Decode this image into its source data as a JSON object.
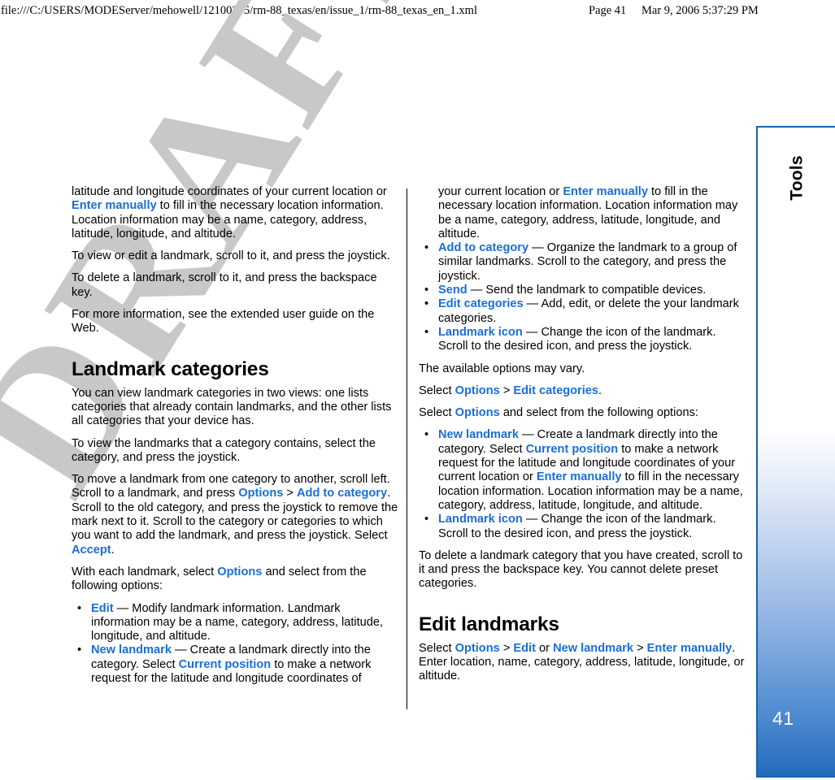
{
  "print_header": {
    "file_path": "file:///C:/USERS/MODEServer/mehowell/12100235/rm-88_texas/en/issue_1/rm-88_texas_en_1.xml",
    "page_label": "Page 41",
    "timestamp": "Mar 9, 2006 5:37:29 PM"
  },
  "watermark": {
    "text": "DRAFT",
    "color": "#c8c8c8"
  },
  "colors": {
    "link": "#1b6ed6",
    "tab_border": "#1663ad",
    "tab_gradient_end": "#2269bd",
    "text": "#000000"
  },
  "side_tab": {
    "label": "Tools",
    "page_number": "41"
  },
  "left_column": {
    "blocks": [
      {
        "type": "paragraph",
        "runs": [
          {
            "text": "latitude and longitude coordinates of your current location or ",
            "style": "normal"
          },
          {
            "text": "Enter manually",
            "style": "link"
          },
          {
            "text": " to fill in the necessary location information. Location information may be a name, category, address, latitude, longitude, and altitude.",
            "style": "normal"
          }
        ]
      },
      {
        "type": "paragraph",
        "runs": [
          {
            "text": "To view or edit a landmark, scroll to it, and press the joystick.",
            "style": "normal"
          }
        ]
      },
      {
        "type": "paragraph",
        "runs": [
          {
            "text": "To delete a landmark, scroll to it, and press the backspace key.",
            "style": "normal"
          }
        ]
      },
      {
        "type": "paragraph",
        "runs": [
          {
            "text": "For more information, see the extended user guide on the Web.",
            "style": "normal"
          }
        ]
      },
      {
        "type": "heading",
        "runs": [
          {
            "text": "Landmark categories",
            "style": "normal"
          }
        ]
      },
      {
        "type": "paragraph",
        "runs": [
          {
            "text": "You can view landmark categories in two views: one lists categories that already contain landmarks, and the other lists all categories that your device has.",
            "style": "normal"
          }
        ]
      },
      {
        "type": "paragraph",
        "runs": [
          {
            "text": "To view the landmarks that a category contains, select the category, and press the joystick.",
            "style": "normal"
          }
        ]
      },
      {
        "type": "paragraph",
        "runs": [
          {
            "text": "To move a landmark from one category to another, scroll left. Scroll to a landmark, and press ",
            "style": "normal"
          },
          {
            "text": "Options",
            "style": "link"
          },
          {
            "text": " > ",
            "style": "gt"
          },
          {
            "text": "Add to category",
            "style": "link"
          },
          {
            "text": ". Scroll to the old category, and press the joystick to remove the mark next to it. Scroll to the category or categories to which you want to add the landmark, and press the joystick. Select ",
            "style": "normal"
          },
          {
            "text": "Accept",
            "style": "link"
          },
          {
            "text": ".",
            "style": "normal"
          }
        ]
      },
      {
        "type": "paragraph",
        "runs": [
          {
            "text": "With each landmark, select ",
            "style": "normal"
          },
          {
            "text": "Options",
            "style": "link"
          },
          {
            "text": " and select from the following options:",
            "style": "normal"
          }
        ]
      },
      {
        "type": "bullet_list",
        "items": [
          {
            "runs": [
              {
                "text": "Edit",
                "style": "link"
              },
              {
                "text": " — Modify landmark information. Landmark information may be a name, category, address, latitude, longitude, and altitude.",
                "style": "normal"
              }
            ]
          },
          {
            "runs": [
              {
                "text": "New landmark",
                "style": "link"
              },
              {
                "text": " — Create a landmark directly into the category. Select ",
                "style": "normal"
              },
              {
                "text": "Current position",
                "style": "link"
              },
              {
                "text": " to make a network request for the latitude and longitude coordinates of",
                "style": "normal"
              }
            ]
          }
        ]
      }
    ]
  },
  "right_column": {
    "blocks": [
      {
        "type": "bullet_continuation",
        "runs": [
          {
            "text": "your current location or ",
            "style": "normal"
          },
          {
            "text": "Enter manually",
            "style": "link"
          },
          {
            "text": " to fill in the necessary location information. Location information may be a name, category, address, latitude, longitude, and altitude.",
            "style": "normal"
          }
        ]
      },
      {
        "type": "bullet_list",
        "items": [
          {
            "runs": [
              {
                "text": "Add to category",
                "style": "link"
              },
              {
                "text": " — Organize the landmark to a group of similar landmarks. Scroll to the category, and press the joystick.",
                "style": "normal"
              }
            ]
          },
          {
            "runs": [
              {
                "text": "Send",
                "style": "link"
              },
              {
                "text": " — Send the landmark to compatible devices.",
                "style": "normal"
              }
            ]
          },
          {
            "runs": [
              {
                "text": "Edit categories",
                "style": "link"
              },
              {
                "text": " — Add, edit, or delete the your landmark categories.",
                "style": "normal"
              }
            ]
          },
          {
            "runs": [
              {
                "text": "Landmark icon",
                "style": "link"
              },
              {
                "text": " — Change the icon of the landmark. Scroll to the desired icon, and press the joystick.",
                "style": "normal"
              }
            ]
          }
        ]
      },
      {
        "type": "paragraph",
        "runs": [
          {
            "text": "The available options may vary.",
            "style": "normal"
          }
        ]
      },
      {
        "type": "paragraph",
        "runs": [
          {
            "text": "Select ",
            "style": "normal"
          },
          {
            "text": "Options",
            "style": "link"
          },
          {
            "text": " > ",
            "style": "gt"
          },
          {
            "text": "Edit categories",
            "style": "link"
          },
          {
            "text": ".",
            "style": "normal"
          }
        ]
      },
      {
        "type": "paragraph",
        "runs": [
          {
            "text": "Select ",
            "style": "normal"
          },
          {
            "text": "Options",
            "style": "link"
          },
          {
            "text": " and select from the following options:",
            "style": "normal"
          }
        ]
      },
      {
        "type": "bullet_list",
        "items": [
          {
            "runs": [
              {
                "text": "New landmark",
                "style": "link"
              },
              {
                "text": " — Create a landmark directly into the category. Select ",
                "style": "normal"
              },
              {
                "text": "Current position",
                "style": "link"
              },
              {
                "text": " to make a network request for the latitude and longitude coordinates of your current location or ",
                "style": "normal"
              },
              {
                "text": "Enter manually",
                "style": "link"
              },
              {
                "text": " to fill in the necessary location information. Location information may be a name, category, address, latitude, longitude, and altitude.",
                "style": "normal"
              }
            ]
          },
          {
            "runs": [
              {
                "text": "Landmark icon",
                "style": "link"
              },
              {
                "text": " — Change the icon of the landmark. Scroll to the desired icon, and press the joystick.",
                "style": "normal"
              }
            ]
          }
        ]
      },
      {
        "type": "paragraph",
        "runs": [
          {
            "text": "To delete a landmark category that you have created, scroll to it and press the backspace key. You cannot delete preset categories.",
            "style": "normal"
          }
        ]
      },
      {
        "type": "heading",
        "runs": [
          {
            "text": "Edit landmarks",
            "style": "normal"
          }
        ]
      },
      {
        "type": "paragraph",
        "runs": [
          {
            "text": "Select ",
            "style": "normal"
          },
          {
            "text": "Options",
            "style": "link"
          },
          {
            "text": " > ",
            "style": "gt"
          },
          {
            "text": "Edit",
            "style": "link"
          },
          {
            "text": " or ",
            "style": "normal"
          },
          {
            "text": "New landmark",
            "style": "link"
          },
          {
            "text": " > ",
            "style": "gt"
          },
          {
            "text": "Enter manually",
            "style": "link"
          },
          {
            "text": ". Enter location, name, category, address, latitude, longitude, or altitude.",
            "style": "normal"
          }
        ]
      }
    ]
  }
}
